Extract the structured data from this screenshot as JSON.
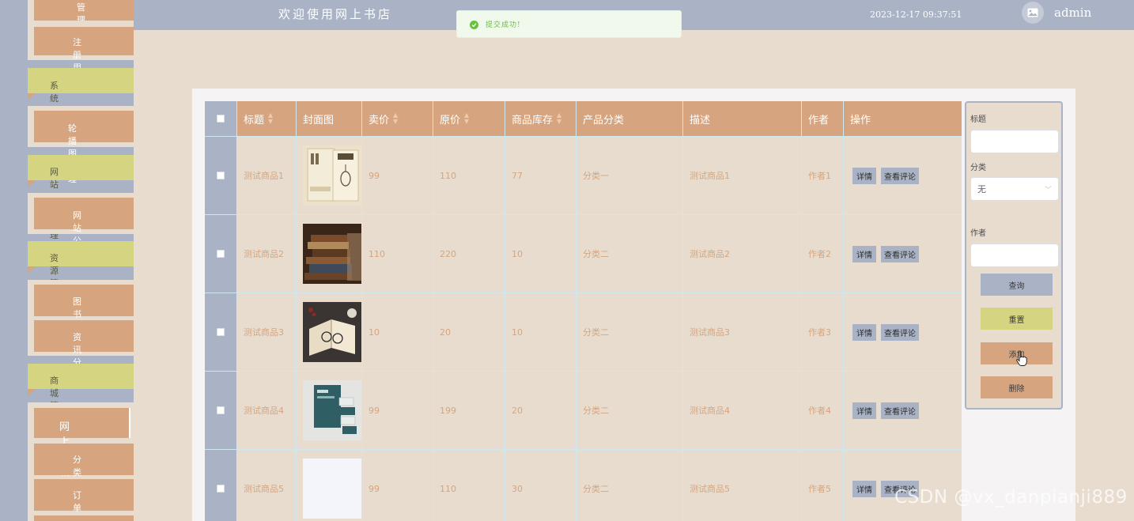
{
  "header": {
    "site_title": "欢迎使用网上书店",
    "datetime": "2023-12-17 09:37:51",
    "username": "admin",
    "avatar_icon": "image-icon"
  },
  "toast": {
    "message": "提交成功!",
    "icon": "check-circle-icon",
    "color": "#67c23a"
  },
  "sidebar": {
    "items": [
      {
        "label": "管理员"
      },
      {
        "label": "注册用户"
      },
      {
        "label": "系统管理"
      },
      {
        "label": "轮播图管理"
      },
      {
        "label": "网站公告管理"
      },
      {
        "label": "网站公告"
      },
      {
        "label": "资源管理"
      },
      {
        "label": "图书资讯"
      },
      {
        "label": "资讯分类"
      },
      {
        "label": "商城管理"
      },
      {
        "label": "网上书城"
      },
      {
        "label": "分类列表"
      },
      {
        "label": "订单列表"
      }
    ]
  },
  "table": {
    "columns": [
      {
        "label": "",
        "sortable": false
      },
      {
        "label": "标题",
        "sortable": true
      },
      {
        "label": "封面图",
        "sortable": false
      },
      {
        "label": "卖价",
        "sortable": true
      },
      {
        "label": "原价",
        "sortable": true
      },
      {
        "label": "商品库存",
        "sortable": true
      },
      {
        "label": "产品分类",
        "sortable": false
      },
      {
        "label": "描述",
        "sortable": false
      },
      {
        "label": "作者",
        "sortable": false
      },
      {
        "label": "操作",
        "sortable": false
      }
    ],
    "detail_label": "详情",
    "review_label": "查看评论",
    "rows": [
      {
        "title": "测试商品1",
        "cover": "book-cover-1",
        "price": "99",
        "original_price": "110",
        "stock": "77",
        "category": "分类一",
        "description": "测试商品1",
        "author": "作者1"
      },
      {
        "title": "测试商品2",
        "cover": "book-cover-2",
        "price": "110",
        "original_price": "220",
        "stock": "10",
        "category": "分类二",
        "description": "测试商品2",
        "author": "作者2"
      },
      {
        "title": "测试商品3",
        "cover": "book-cover-3",
        "price": "10",
        "original_price": "20",
        "stock": "10",
        "category": "分类二",
        "description": "测试商品3",
        "author": "作者3"
      },
      {
        "title": "测试商品4",
        "cover": "book-cover-4",
        "price": "99",
        "original_price": "199",
        "stock": "20",
        "category": "分类二",
        "description": "测试商品4",
        "author": "作者4"
      },
      {
        "title": "测试商品5",
        "cover": "blank",
        "price": "99",
        "original_price": "110",
        "stock": "30",
        "category": "分类二",
        "description": "测试商品5",
        "author": "作者5"
      }
    ]
  },
  "search": {
    "title_label": "标题",
    "title_value": "",
    "category_label": "分类",
    "category_value": "无",
    "author_label": "作者",
    "author_value": "",
    "query_label": "查询",
    "reset_label": "重置",
    "add_label": "添加",
    "delete_label": "删除"
  },
  "watermark": "CSDN @vx_danpianji889",
  "colors": {
    "accent_tan": "#d6a57f",
    "accent_slate": "#a9b3c5",
    "accent_olive": "#d5d581",
    "background": "#e8dccf"
  }
}
